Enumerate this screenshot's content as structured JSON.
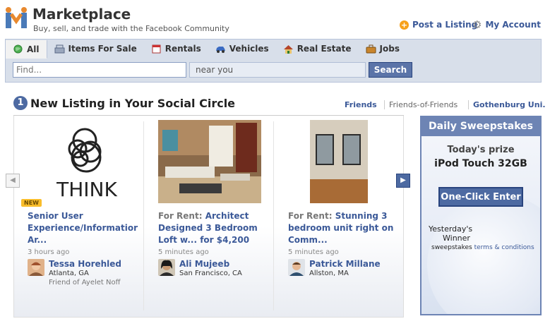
{
  "header": {
    "title": "Marketplace",
    "tagline": "Buy, sell, and trade with the Facebook Community",
    "post_listing": "Post a Listing",
    "my_account": "My Account"
  },
  "tabs": [
    {
      "label": "All",
      "icon": "globe-icon",
      "active": true
    },
    {
      "label": "Items For Sale",
      "icon": "cash-register-icon"
    },
    {
      "label": "Rentals",
      "icon": "calendar-icon"
    },
    {
      "label": "Vehicles",
      "icon": "car-icon"
    },
    {
      "label": "Real Estate",
      "icon": "house-icon"
    },
    {
      "label": "Jobs",
      "icon": "briefcase-icon"
    }
  ],
  "search": {
    "placeholder": "Find...",
    "location": "near you",
    "button": "Search"
  },
  "section": {
    "number": "1",
    "title": "New Listing in Your Social Circle",
    "filters": [
      "Friends",
      "Friends-of-Friends",
      "Gothenburg Uni."
    ]
  },
  "listings": [
    {
      "badge": "NEW",
      "category": "",
      "title": "Senior User Experience/Informatior Ar...",
      "time": "3 hours ago",
      "seller_name": "Tessa Horehled",
      "seller_location": "Atlanta, GA",
      "seller_relation": "Friend of Ayelet Noff",
      "image_text": "THINK"
    },
    {
      "category": "For Rent:",
      "title": "Architect Designed 3 Bedroom Loft w... for $4,200",
      "time": "5 minutes ago",
      "seller_name": "Ali Mujeeb",
      "seller_location": "San Francisco, CA"
    },
    {
      "category": "For Rent:",
      "title": "Stunning 3 bedroom unit right on Comm...",
      "time": "5 minutes ago",
      "seller_name": "Patrick Millane",
      "seller_location": "Allston, MA"
    }
  ],
  "sweepstakes": {
    "title": "Daily Sweepstakes",
    "prize_label": "Today's prize",
    "prize": "iPod Touch 32GB",
    "button": "One-Click Enter",
    "yesterday_line1": "Yesterday's",
    "yesterday_line2": "Winner",
    "terms_prefix": "sweepstakes",
    "terms_link": "terms & conditions"
  },
  "colors": {
    "brand": "#3b5998",
    "nav_bg": "#d8dfea",
    "accent_orange": "#f7a11a"
  }
}
